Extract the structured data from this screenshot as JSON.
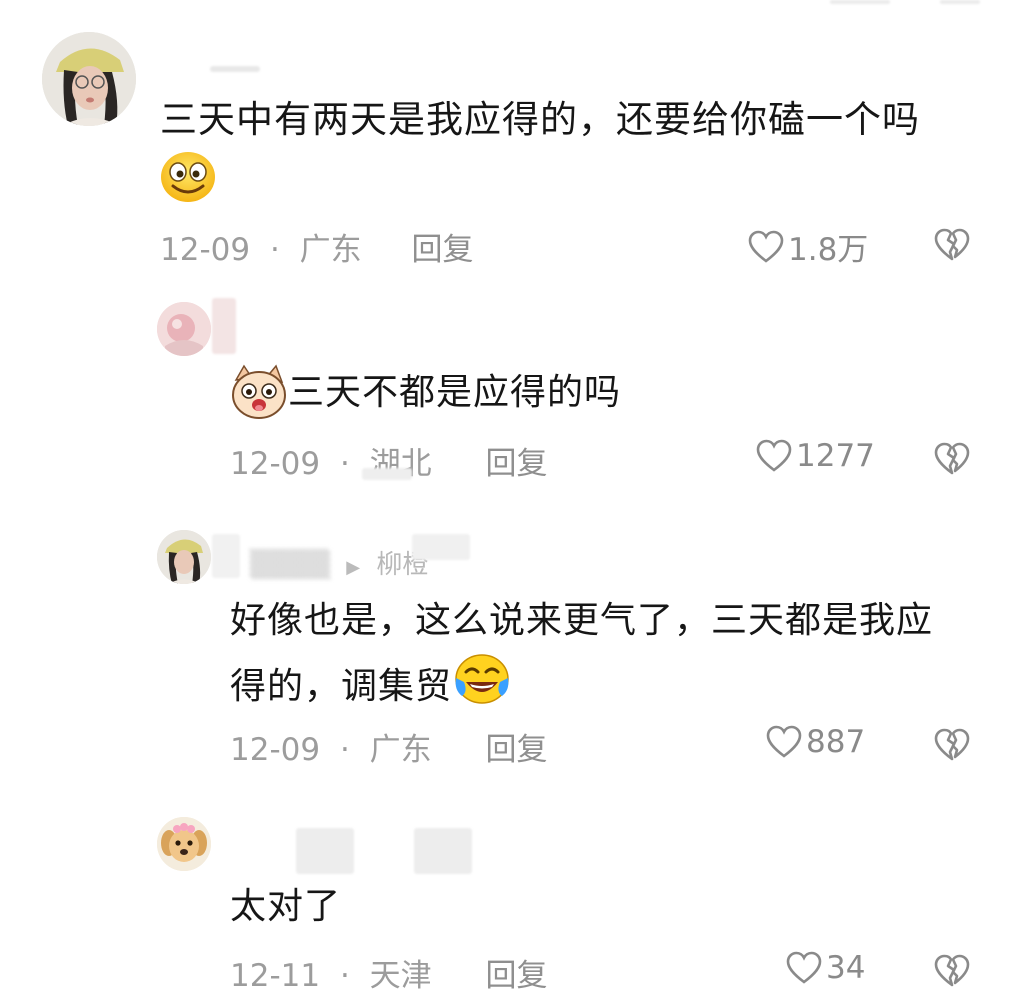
{
  "comments": [
    {
      "text": "三天中有两天是我应得的，还要给你磕一个吗",
      "date": "12-09",
      "sep": "·",
      "location": "广东",
      "reply_label": "回复",
      "likes": "1.8万",
      "emoji": "smile-emoji"
    },
    {
      "text": "三天不都是应得的吗",
      "date": "12-09",
      "sep": "·",
      "location": "湖北",
      "reply_label": "回复",
      "likes": "1277",
      "emoji": "shocked-dog-emoji"
    },
    {
      "username_partial": "柳橙",
      "text_line1": "好像也是，这么说来更气了，三天都是我应",
      "text_line2": "得的，调集贸",
      "date": "12-09",
      "sep": "·",
      "location": "广东",
      "reply_label": "回复",
      "likes": "887",
      "emoji": "laugh-cry-emoji"
    },
    {
      "text": "太对了",
      "date": "12-11",
      "sep": "·",
      "location": "天津",
      "reply_label": "回复",
      "likes": "34"
    }
  ],
  "colors": {
    "text": "#161616",
    "meta": "#9c9c9c",
    "icon": "#8a8a8a"
  }
}
